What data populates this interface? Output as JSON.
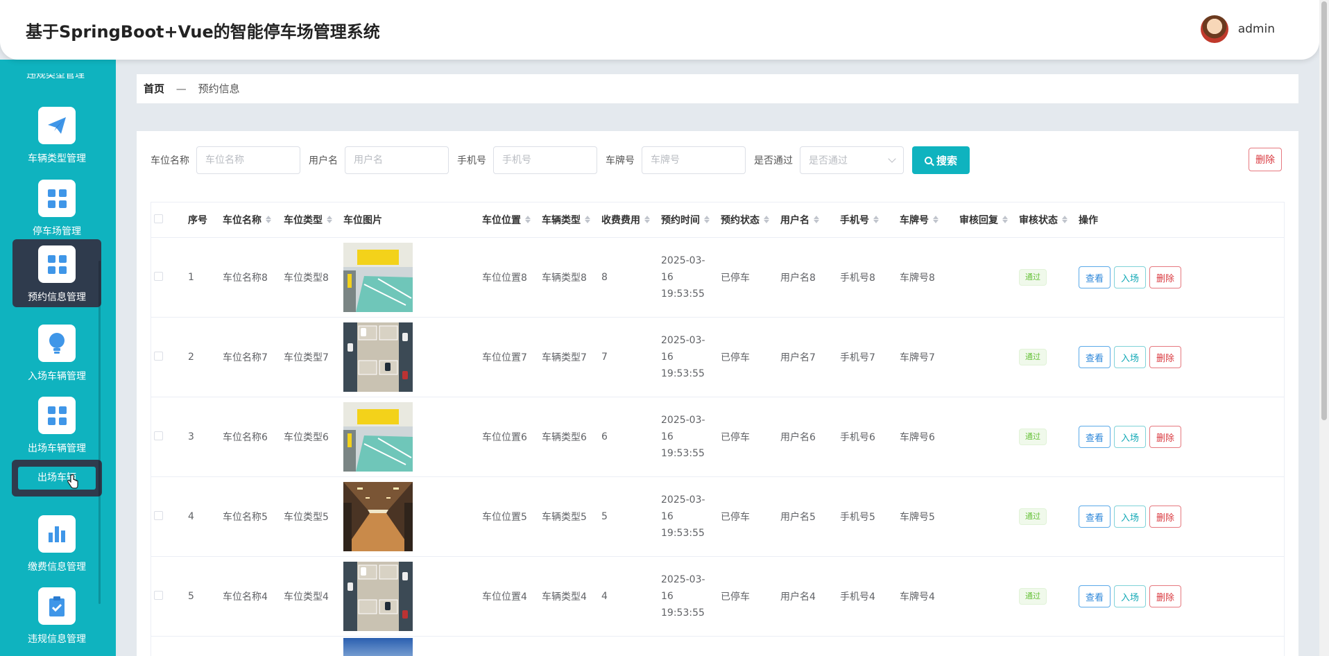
{
  "header": {
    "title": "基于SpringBoot+Vue的智能停车场管理系统",
    "username": "admin"
  },
  "sidebar": {
    "cut_label": "违规类型管理",
    "items": [
      {
        "label": "车辆类型管理",
        "icon": "paper-plane-icon"
      },
      {
        "label": "停车场管理",
        "icon": "grid-icon"
      },
      {
        "label": "预约信息管理",
        "icon": "grid-icon",
        "active": true
      },
      {
        "label": "入场车辆管理",
        "icon": "bulb-icon"
      },
      {
        "label": "出场车辆管理",
        "icon": "grid-icon"
      },
      {
        "label": "缴费信息管理",
        "icon": "bar-chart-icon"
      },
      {
        "label": "违规信息管理",
        "icon": "clipboard-check-icon"
      }
    ],
    "sub_item": "出场车辆"
  },
  "breadcrumb": {
    "home": "首页",
    "sep": "—",
    "current": "预约信息"
  },
  "search": {
    "fields": [
      {
        "label": "车位名称",
        "placeholder": "车位名称"
      },
      {
        "label": "用户名",
        "placeholder": "用户名"
      },
      {
        "label": "手机号",
        "placeholder": "手机号"
      },
      {
        "label": "车牌号",
        "placeholder": "车牌号"
      }
    ],
    "approve_label": "是否通过",
    "approve_placeholder": "是否通过",
    "search_button": "搜索",
    "delete_button": "删除"
  },
  "table": {
    "columns": [
      "序号",
      "车位名称",
      "车位类型",
      "车位图片",
      "车位位置",
      "车辆类型",
      "收费费用",
      "预约时间",
      "预约状态",
      "用户名",
      "手机号",
      "车牌号",
      "审核回复",
      "审核状态",
      "操作"
    ],
    "rows": [
      {
        "index": "1",
        "name": "车位名称8",
        "type": "车位类型8",
        "image": "garage-teal",
        "location": "车位位置8",
        "vehicle_type": "车辆类型8",
        "fee": "8",
        "date": "2025-03-16",
        "time": "19:53:55",
        "status": "已停车",
        "user": "用户名8",
        "phone": "手机号8",
        "plate": "车牌号8",
        "reply": "",
        "audit": "通过"
      },
      {
        "index": "2",
        "name": "车位名称7",
        "type": "车位类型7",
        "image": "lot-aerial",
        "location": "车位位置7",
        "vehicle_type": "车辆类型7",
        "fee": "7",
        "date": "2025-03-16",
        "time": "19:53:55",
        "status": "已停车",
        "user": "用户名7",
        "phone": "手机号7",
        "plate": "车牌号7",
        "reply": "",
        "audit": "通过"
      },
      {
        "index": "3",
        "name": "车位名称6",
        "type": "车位类型6",
        "image": "garage-teal",
        "location": "车位位置6",
        "vehicle_type": "车辆类型6",
        "fee": "6",
        "date": "2025-03-16",
        "time": "19:53:55",
        "status": "已停车",
        "user": "用户名6",
        "phone": "手机号6",
        "plate": "车牌号6",
        "reply": "",
        "audit": "通过"
      },
      {
        "index": "4",
        "name": "车位名称5",
        "type": "车位类型5",
        "image": "garage-tunnel",
        "location": "车位位置5",
        "vehicle_type": "车辆类型5",
        "fee": "5",
        "date": "2025-03-16",
        "time": "19:53:55",
        "status": "已停车",
        "user": "用户名5",
        "phone": "手机号5",
        "plate": "车牌号5",
        "reply": "",
        "audit": "通过"
      },
      {
        "index": "5",
        "name": "车位名称4",
        "type": "车位类型4",
        "image": "lot-aerial",
        "location": "车位位置4",
        "vehicle_type": "车辆类型4",
        "fee": "4",
        "date": "2025-03-16",
        "time": "19:53:55",
        "status": "已停车",
        "user": "用户名4",
        "phone": "手机号4",
        "plate": "车牌号4",
        "reply": "",
        "audit": "通过"
      }
    ],
    "actions": {
      "view": "查看",
      "enter": "入场",
      "delete": "删除"
    }
  },
  "colors": {
    "accent": "#0fb3bf",
    "sidebar_active": "#2f3b4d",
    "danger": "#d9393f",
    "success": "#67c23a"
  }
}
